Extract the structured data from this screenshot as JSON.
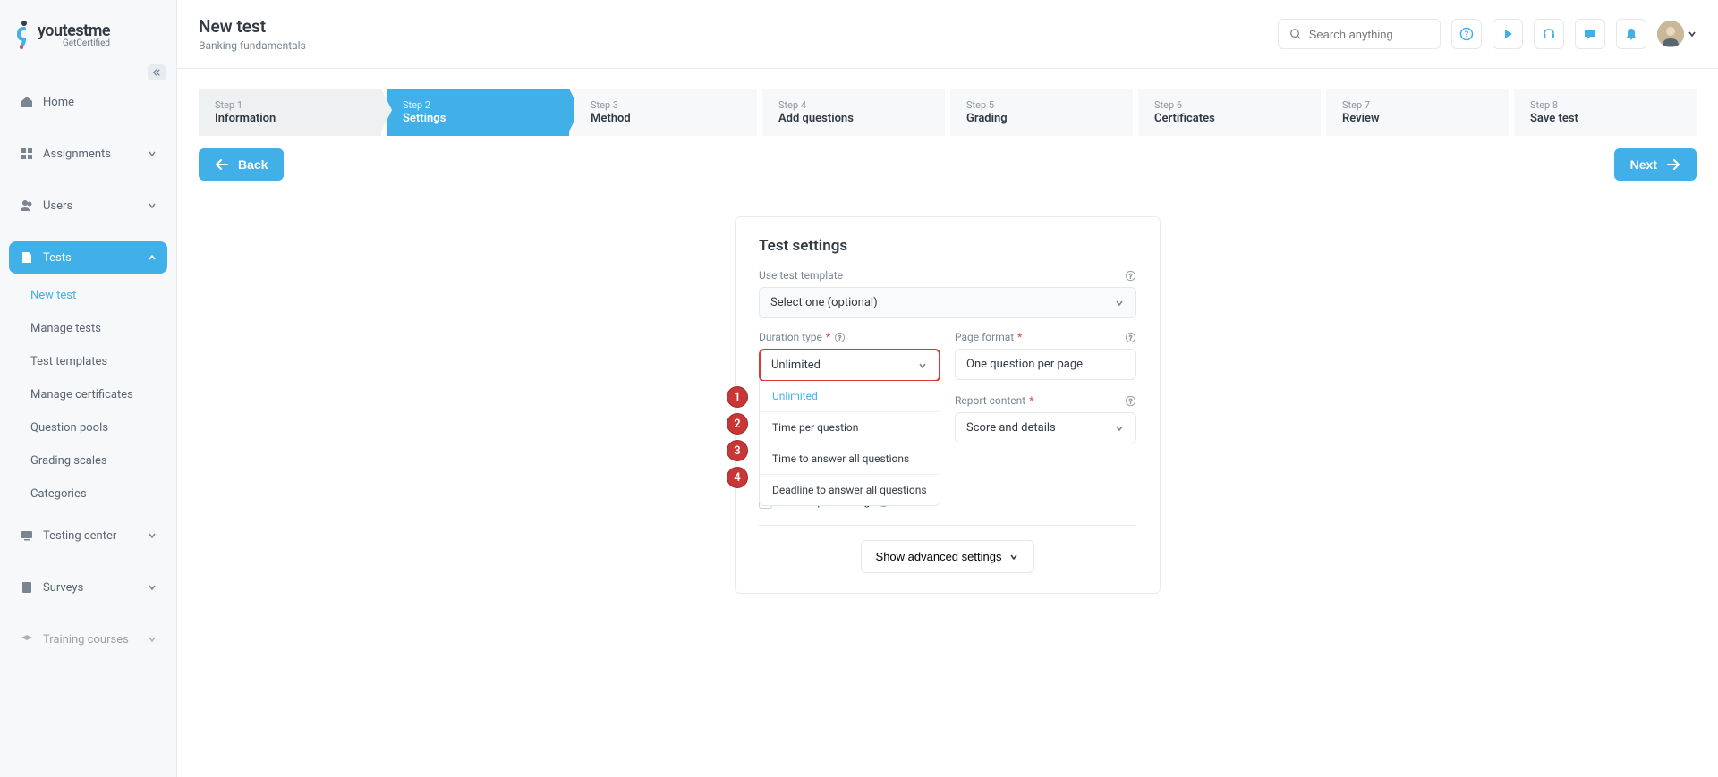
{
  "brand": {
    "name_prefix": "you",
    "name_mid": "test",
    "name_suffix": "me",
    "subtitle": "GetCertified"
  },
  "header": {
    "title": "New test",
    "subtitle": "Banking fundamentals",
    "search_placeholder": "Search anything"
  },
  "sidebar": {
    "items": [
      {
        "label": "Home"
      },
      {
        "label": "Assignments"
      },
      {
        "label": "Users"
      },
      {
        "label": "Tests"
      },
      {
        "label": "Testing center"
      },
      {
        "label": "Surveys"
      },
      {
        "label": "Training courses"
      }
    ],
    "tests_sub": [
      {
        "label": "New test"
      },
      {
        "label": "Manage tests"
      },
      {
        "label": "Test templates"
      },
      {
        "label": "Manage certificates"
      },
      {
        "label": "Question pools"
      },
      {
        "label": "Grading scales"
      },
      {
        "label": "Categories"
      }
    ]
  },
  "stepper": [
    {
      "num": "Step 1",
      "label": "Information"
    },
    {
      "num": "Step 2",
      "label": "Settings"
    },
    {
      "num": "Step 3",
      "label": "Method"
    },
    {
      "num": "Step 4",
      "label": "Add questions"
    },
    {
      "num": "Step 5",
      "label": "Grading"
    },
    {
      "num": "Step 6",
      "label": "Certificates"
    },
    {
      "num": "Step 7",
      "label": "Review"
    },
    {
      "num": "Step 8",
      "label": "Save test"
    }
  ],
  "buttons": {
    "back": "Back",
    "next": "Next"
  },
  "card": {
    "title": "Test settings",
    "template_label": "Use test template",
    "template_value": "Select one (optional)",
    "duration_label": "Duration type",
    "duration_value": "Unlimited",
    "duration_options": [
      "Unlimited",
      "Time per question",
      "Time to answer all questions",
      "Deadline to answer all questions"
    ],
    "page_format_label": "Page format",
    "page_format_value": "One question per page",
    "report_label": "Report content",
    "report_value": "Score and details",
    "proctoring_label": "Enable proctoring",
    "show_advanced": "Show advanced settings"
  },
  "callouts": [
    "1",
    "2",
    "3",
    "4"
  ]
}
